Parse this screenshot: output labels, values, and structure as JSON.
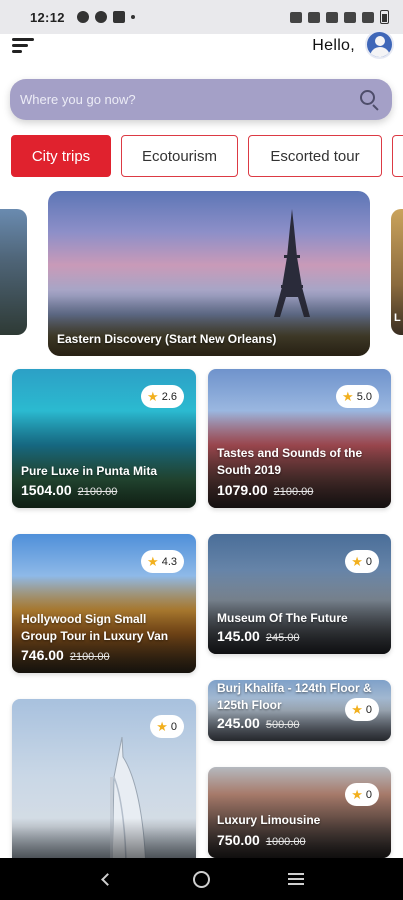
{
  "status_bar": {
    "time": "12:12"
  },
  "header": {
    "greeting": "Hello,"
  },
  "search": {
    "placeholder": "Where you go now?"
  },
  "categories": [
    "City trips",
    "Ecotourism",
    "Escorted tour"
  ],
  "hero": {
    "title": "Eastern Discovery (Start New Orleans)"
  },
  "hero_side_right": {
    "letter": "L"
  },
  "tours": [
    {
      "title": "Pure Luxe in Punta Mita",
      "rating": "2.6",
      "price": "1504.00",
      "old_price": "2100.00"
    },
    {
      "title": "Tastes and Sounds of the South 2019",
      "rating": "5.0",
      "price": "1079.00",
      "old_price": "2100.00"
    },
    {
      "title": "Hollywood Sign Small Group Tour in Luxury Van",
      "rating": "4.3",
      "price": "746.00",
      "old_price": "2100.00"
    },
    {
      "title": "Museum Of The Future",
      "rating": "0",
      "price": "145.00",
      "old_price": "245.00"
    },
    {
      "title": "Burj Khalifa - 124th Floor & 125th Floor",
      "rating": "0",
      "price": "245.00",
      "old_price": "500.00"
    },
    {
      "title": "",
      "rating": "0",
      "price": "",
      "old_price": ""
    },
    {
      "title": "Luxury Limousine",
      "rating": "0",
      "price": "750.00",
      "old_price": "1000.00"
    }
  ],
  "colors": {
    "accent": "#e0222e",
    "search_bg": "#a4a0c7",
    "star": "#f2b01e"
  },
  "icons": [
    "menu-icon",
    "avatar",
    "search-icon",
    "star-icon",
    "back-icon",
    "home-icon",
    "recents-icon"
  ]
}
